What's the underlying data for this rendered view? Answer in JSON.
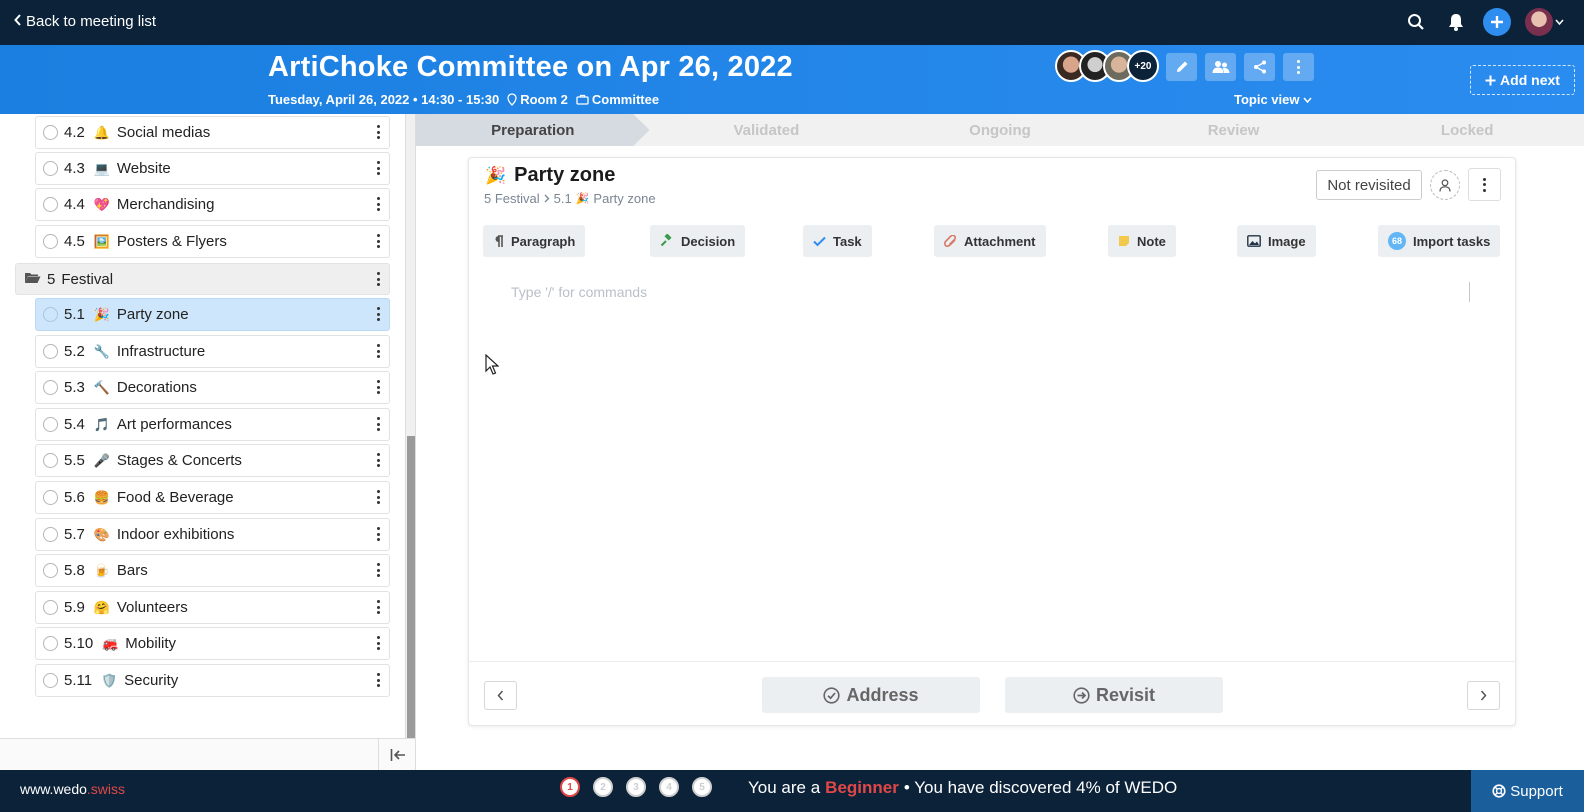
{
  "topbar": {
    "back_label": "Back to meeting list"
  },
  "header": {
    "title": "ArtiChoke Committee on Apr 26, 2022",
    "date_time": "Tuesday, April 26, 2022 • 14:30 - 15:30",
    "room": "Room 2",
    "type": "Committee",
    "more_attendees": "+20",
    "topic_view_label": "Topic view",
    "add_next_label": "Add next"
  },
  "sidebar": {
    "items_before": [
      {
        "num": "4.2",
        "emoji": "🔔",
        "label": "Social medias"
      },
      {
        "num": "4.3",
        "emoji": "💻",
        "label": "Website"
      },
      {
        "num": "4.4",
        "emoji": "💖",
        "label": "Merchandising"
      },
      {
        "num": "4.5",
        "emoji": "🖼️",
        "label": "Posters & Flyers"
      }
    ],
    "folder": {
      "num": "5",
      "label": "Festival"
    },
    "items": [
      {
        "num": "5.1",
        "emoji": "🎉",
        "label": "Party zone"
      },
      {
        "num": "5.2",
        "emoji": "🔧",
        "label": "Infrastructure"
      },
      {
        "num": "5.3",
        "emoji": "🔨",
        "label": "Decorations"
      },
      {
        "num": "5.4",
        "emoji": "🎵",
        "label": "Art performances"
      },
      {
        "num": "5.5",
        "emoji": "🎤",
        "label": "Stages & Concerts"
      },
      {
        "num": "5.6",
        "emoji": "🍔",
        "label": "Food & Beverage"
      },
      {
        "num": "5.7",
        "emoji": "🎨",
        "label": "Indoor exhibitions"
      },
      {
        "num": "5.8",
        "emoji": "🍺",
        "label": "Bars"
      },
      {
        "num": "5.9",
        "emoji": "🤗",
        "label": "Volunteers"
      },
      {
        "num": "5.10",
        "emoji": "🚒",
        "label": "Mobility"
      },
      {
        "num": "5.11",
        "emoji": "🛡️",
        "label": "Security"
      }
    ]
  },
  "steps": [
    "Preparation",
    "Validated",
    "Ongoing",
    "Review",
    "Locked"
  ],
  "topic": {
    "emoji": "🎉",
    "title": "Party zone",
    "breadcrumb_section": "5 Festival",
    "breadcrumb_num": "5.1",
    "breadcrumb_emoji": "🎉",
    "breadcrumb_topic": "Party zone",
    "status_label": "Not revisited"
  },
  "toolbar": {
    "paragraph": "Paragraph",
    "decision": "Decision",
    "task": "Task",
    "attachment": "Attachment",
    "note": "Note",
    "image": "Image",
    "import_tasks": "Import tasks",
    "import_badge": "68"
  },
  "editor": {
    "placeholder": "Type '/' for commands"
  },
  "footer_actions": {
    "address": "Address",
    "revisit": "Revisit"
  },
  "bottombar": {
    "site_prefix": "www.wedo",
    "site_suffix": ".swiss",
    "progress": [
      "1",
      "2",
      "3",
      "4",
      "5"
    ],
    "level_prefix": "You are a",
    "level": "Beginner",
    "level_suffix": "• You have discovered 4% of WEDO",
    "support": "Support"
  },
  "colors": {
    "topbar": "#0b2239",
    "header": "#1a7fe0",
    "active_item": "#cde6fb",
    "accent_red": "#e04848"
  }
}
